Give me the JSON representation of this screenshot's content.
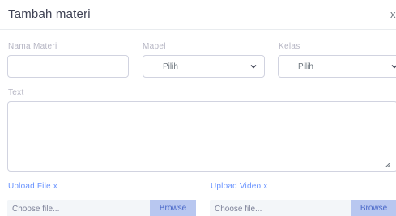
{
  "modal": {
    "title": "Tambah materi",
    "close": "x"
  },
  "fields": {
    "nama_label": "Nama Materi",
    "nama_value": "",
    "mapel_label": "Mapel",
    "mapel_selected": "Pilih",
    "kelas_label": "Kelas",
    "kelas_selected": "Pilih",
    "text_label": "Text",
    "text_value": ""
  },
  "uploads": {
    "file_label": "Upload File x",
    "file_placeholder": "Choose file...",
    "file_button": "Browse",
    "video_label": "Upload Video x",
    "video_placeholder": "Choose file...",
    "video_button": "Browse"
  },
  "icons": {
    "select_chevron": "chevron-down-icon",
    "resize": "resize-handle-icon"
  }
}
